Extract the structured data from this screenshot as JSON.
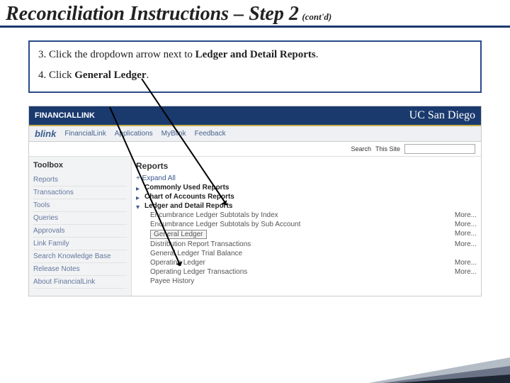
{
  "title": {
    "main": "Reconciliation Instructions – Step 2",
    "suffix": "(cont'd)"
  },
  "instructions": {
    "line3_prefix": "3. Click the dropdown arrow next to ",
    "line3_strong": "Ledger and Detail Reports",
    "line3_suffix": ".",
    "line4_prefix": "4. Click ",
    "line4_strong": "General Ledger",
    "line4_suffix": "."
  },
  "app": {
    "brand": "FINANCIALLINK",
    "org": "UC San Diego",
    "nav_first": "blink",
    "nav": [
      "FinancialLink",
      "Applications",
      "MyBlink",
      "Feedback"
    ],
    "search_label": "Search",
    "search_scope": "This Site",
    "search_placeholder": ""
  },
  "sidebar": {
    "header": "Toolbox",
    "items": [
      "Reports",
      "Transactions",
      "Tools",
      "Queries",
      "Approvals",
      "Link Family",
      "Search Knowledge Base",
      "Release Notes",
      "About FinancialLink"
    ]
  },
  "reports": {
    "header": "Reports",
    "expand_all": "+ Expand All",
    "groups": [
      {
        "label": "Commonly Used Reports",
        "bold": true,
        "expanded": false
      },
      {
        "label": "Chart of Accounts Reports",
        "bold": true,
        "expanded": false
      },
      {
        "label": "Ledger and Detail Reports",
        "bold": true,
        "expanded": true
      }
    ],
    "ledger_items": [
      {
        "label": "Encumbrance Ledger Subtotals by Index",
        "more": "More..."
      },
      {
        "label": "Encumbrance Ledger Subtotals by Sub Account",
        "more": "More..."
      },
      {
        "label": "General Ledger",
        "more": "More...",
        "highlight": true
      },
      {
        "label": "Distribution Report Transactions",
        "more": "More..."
      },
      {
        "label": "General Ledger Trial Balance",
        "more": ""
      },
      {
        "label": "Operating Ledger",
        "more": "More..."
      },
      {
        "label": "Operating Ledger Transactions",
        "more": "More..."
      },
      {
        "label": "Payee History",
        "more": ""
      }
    ]
  }
}
